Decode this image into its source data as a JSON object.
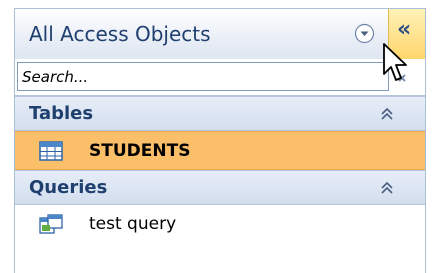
{
  "nav_pane": {
    "title": "All Access Objects",
    "dropdown_icon": "circle-chevron-down-icon",
    "collapse_label": "«",
    "search": {
      "placeholder": "Search...",
      "value": ""
    },
    "groups": [
      {
        "label": "Tables",
        "items": [
          {
            "label": "STUDENTS",
            "icon": "table-icon",
            "selected": true
          }
        ]
      },
      {
        "label": "Queries",
        "items": [
          {
            "label": "test query",
            "icon": "query-icon",
            "selected": false
          }
        ]
      }
    ]
  },
  "colors": {
    "selected_background": "#fbbf6a",
    "header_text": "#1f3f6f",
    "collapse_button": "#ffd56a"
  }
}
